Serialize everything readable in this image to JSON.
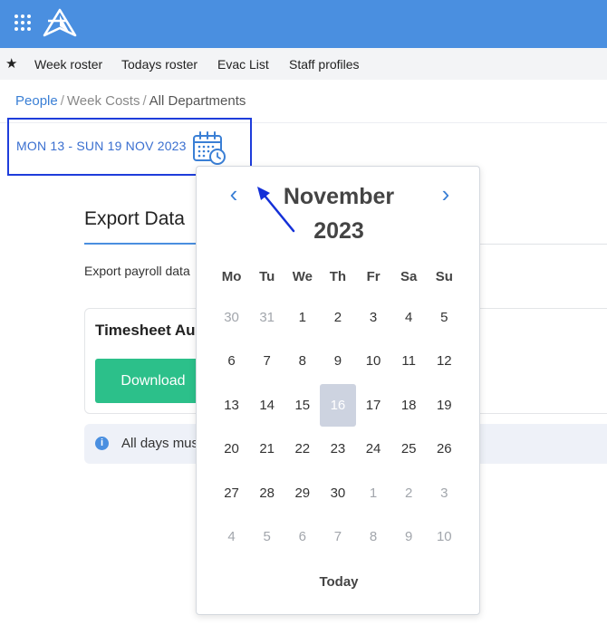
{
  "colors": {
    "topbar": "#4a8fe0",
    "accent": "#3a7fd5",
    "download": "#2cc08a",
    "highlight_border": "#1e3ddb",
    "selected_day": "#cdd3e0"
  },
  "topbar": {
    "apps_icon": "grid-icon",
    "logo_icon": "logo-icon"
  },
  "navbar": {
    "star_icon": "star-icon",
    "items": [
      "Week roster",
      "Todays roster",
      "Evac List",
      "Staff profiles"
    ]
  },
  "breadcrumb": {
    "items": [
      "People",
      "Week Costs",
      "All Departments"
    ],
    "separator": "/"
  },
  "date_range": {
    "label": "MON 13 - SUN 19 NOV 2023",
    "icon": "calendar-clock-icon"
  },
  "page": {
    "title": "Export Data",
    "description": "Export payroll data",
    "card_title": "Timesheet Audit",
    "download_label": "Download",
    "info_icon": "info-icon",
    "info_text": "All days must"
  },
  "calendar": {
    "month": "November",
    "year": "2023",
    "prev_icon": "chevron-left-icon",
    "next_icon": "chevron-right-icon",
    "weekdays": [
      "Mo",
      "Tu",
      "We",
      "Th",
      "Fr",
      "Sa",
      "Su"
    ],
    "weeks": [
      [
        "30",
        "31",
        "1",
        "2",
        "3",
        "4",
        "5"
      ],
      [
        "6",
        "7",
        "8",
        "9",
        "10",
        "11",
        "12"
      ],
      [
        "13",
        "14",
        "15",
        "16",
        "17",
        "18",
        "19"
      ],
      [
        "20",
        "21",
        "22",
        "23",
        "24",
        "25",
        "26"
      ],
      [
        "27",
        "28",
        "29",
        "30",
        "1",
        "2",
        "3"
      ],
      [
        "4",
        "5",
        "6",
        "7",
        "8",
        "9",
        "10"
      ]
    ],
    "muted": [
      [
        0,
        0
      ],
      [
        0,
        1
      ],
      [
        4,
        4
      ],
      [
        4,
        5
      ],
      [
        4,
        6
      ],
      [
        5,
        0
      ],
      [
        5,
        1
      ],
      [
        5,
        2
      ],
      [
        5,
        3
      ],
      [
        5,
        4
      ],
      [
        5,
        5
      ],
      [
        5,
        6
      ]
    ],
    "selected": [
      2,
      3
    ],
    "today_label": "Today"
  },
  "annotation": {
    "arrow_icon": "annotation-arrow-icon"
  }
}
